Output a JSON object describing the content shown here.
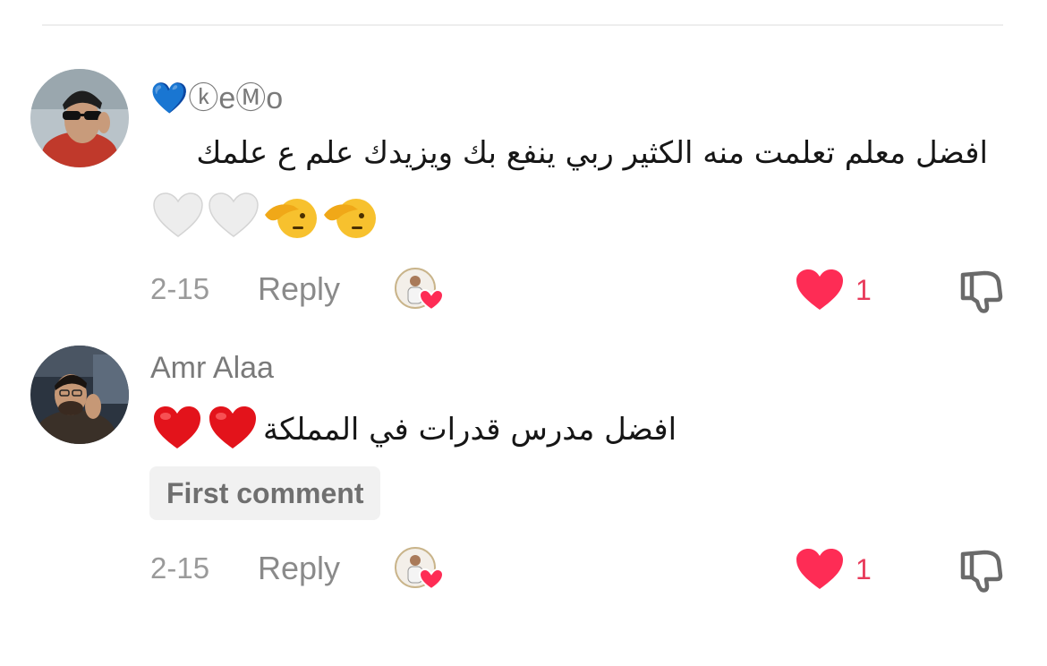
{
  "comments": [
    {
      "username": "💙ⓚeⓂo",
      "text": "افضل معلم تعلمت منه الكثير ربي ينفع بك ويزيدك علم ع علمك",
      "emojis": [
        "🤍",
        "🤍",
        "🫡",
        "🫡"
      ],
      "date": "2-15",
      "reply_label": "Reply",
      "like_count": "1",
      "liked": true,
      "creator_liked": true
    },
    {
      "username": "Amr Alaa",
      "text": "افضل مدرس قدرات في المملكة",
      "emojis": [
        "❤️",
        "❤️"
      ],
      "badge": "First comment",
      "date": "2-15",
      "reply_label": "Reply",
      "like_count": "1",
      "liked": true,
      "creator_liked": true
    }
  ],
  "colors": {
    "like_red": "#fe2c55",
    "text": "#161616",
    "muted": "#8a8a8a"
  },
  "icons": {
    "like": "heart-icon",
    "dislike": "thumbs-down-icon",
    "creator_liked": "creator-liked-avatar-heart"
  }
}
